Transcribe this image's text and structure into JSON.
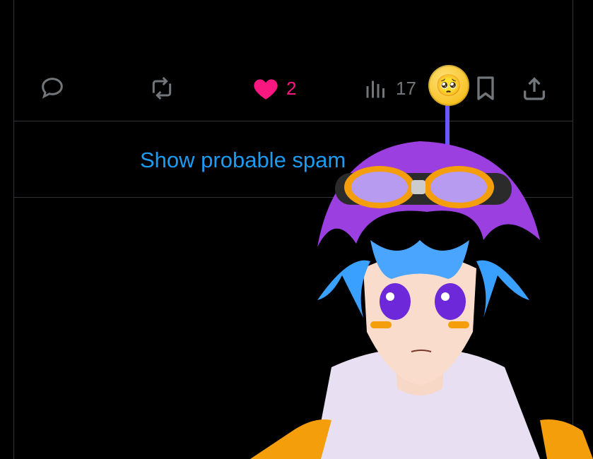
{
  "actions": {
    "reply_icon": "comment-bubble",
    "repost_icon": "repost-arrows",
    "like_icon": "heart",
    "like_count": "2",
    "views_icon": "bar-chart",
    "views_count": "17",
    "bookmark_icon": "bookmark",
    "share_icon": "upload",
    "like_color": "#f91880",
    "muted_color": "#71767b"
  },
  "spam": {
    "link_text": "Show probable spam",
    "link_color": "#1d9bf0"
  },
  "overlay": {
    "emoji_icon": "pleading-face"
  }
}
